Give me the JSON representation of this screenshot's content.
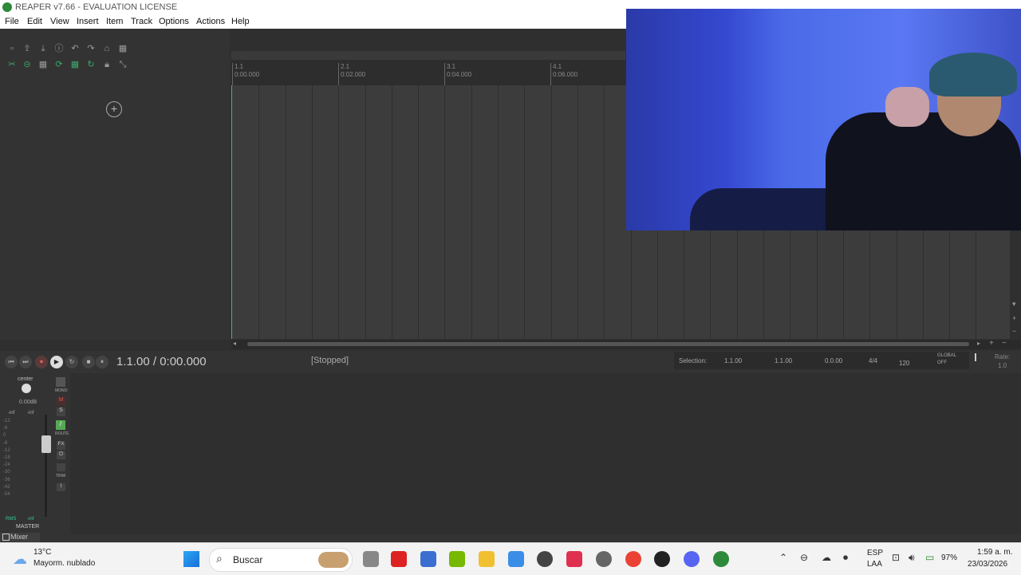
{
  "window": {
    "title": "REAPER v7.66 - EVALUATION LICENSE"
  },
  "menu": [
    "File",
    "Edit",
    "View",
    "Insert",
    "Item",
    "Track",
    "Options",
    "Actions",
    "Help"
  ],
  "ruler": {
    "markers": [
      {
        "bar": "1.1",
        "time": "0:00.000"
      },
      {
        "bar": "2.1",
        "time": "0:02.000"
      },
      {
        "bar": "3.1",
        "time": "0:04.000"
      },
      {
        "bar": "4.1",
        "time": "0:06.000"
      }
    ]
  },
  "transport": {
    "position": "1.1.00 / 0:00.000",
    "status": "[Stopped]",
    "selection_label": "Selection:",
    "sel_start": "1.1.00",
    "sel_end": "1.1.00",
    "sel_length": "0.0.00",
    "time_sig": "4/4",
    "tempo": "120",
    "global_label": "GLOBAL",
    "global_state": "OFF",
    "rate_label": "Rate:",
    "rate": "1.0"
  },
  "mixer": {
    "pan": "center",
    "volume": "0.00dB",
    "peak_l": "-inf",
    "peak_r": "-inf",
    "scale": [
      "-12",
      "-6",
      "0",
      "-6",
      "-12",
      "-18",
      "-24",
      "-30",
      "-36",
      "-42",
      "-54"
    ],
    "mono": "MONO",
    "mute": "M",
    "solo": "S",
    "route": "ROUTE",
    "fx": "FX",
    "trim": "TRIM",
    "info": "i",
    "rms_label": "RMS",
    "rms": "-inf",
    "track_name": "MASTER",
    "tab": "Mixer"
  },
  "taskbar": {
    "weather_temp": "13°C",
    "weather_desc": "Mayorm. nublado",
    "search": "Buscar",
    "lang": "ESP",
    "layout": "LAA",
    "battery": "97%",
    "time": "1:59 a. m.",
    "date": "23/03/2026"
  }
}
